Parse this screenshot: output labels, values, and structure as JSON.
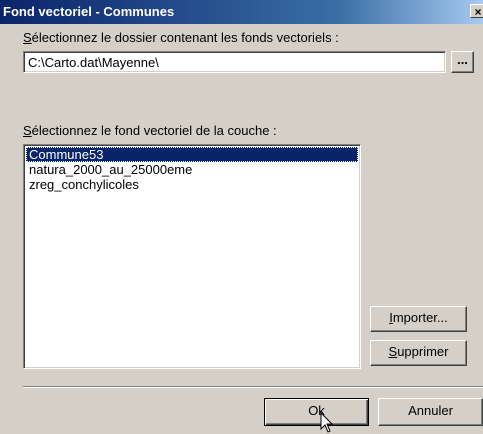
{
  "window": {
    "title": "Fond vectoriel - Communes",
    "close_label": "×"
  },
  "folder": {
    "label_mnemonic": "S",
    "label_rest": "électionnez le dossier contenant les fonds vectoriels :",
    "path_value": "C:\\Carto.dat\\Mayenne\\",
    "browse_label": "..."
  },
  "layer": {
    "label_mnemonic": "S",
    "label_rest": "électionnez le fond vectoriel de la couche :",
    "items": [
      "Commune53",
      "natura_2000_au_25000eme",
      "zreg_conchylicoles"
    ],
    "selected": "Commune53"
  },
  "buttons": {
    "import_mnemonic": "I",
    "import_rest": "mporter...",
    "delete_mnemonic": "S",
    "delete_rest": "upprimer",
    "ok_label": "Ok",
    "cancel_label": "Annuler"
  }
}
